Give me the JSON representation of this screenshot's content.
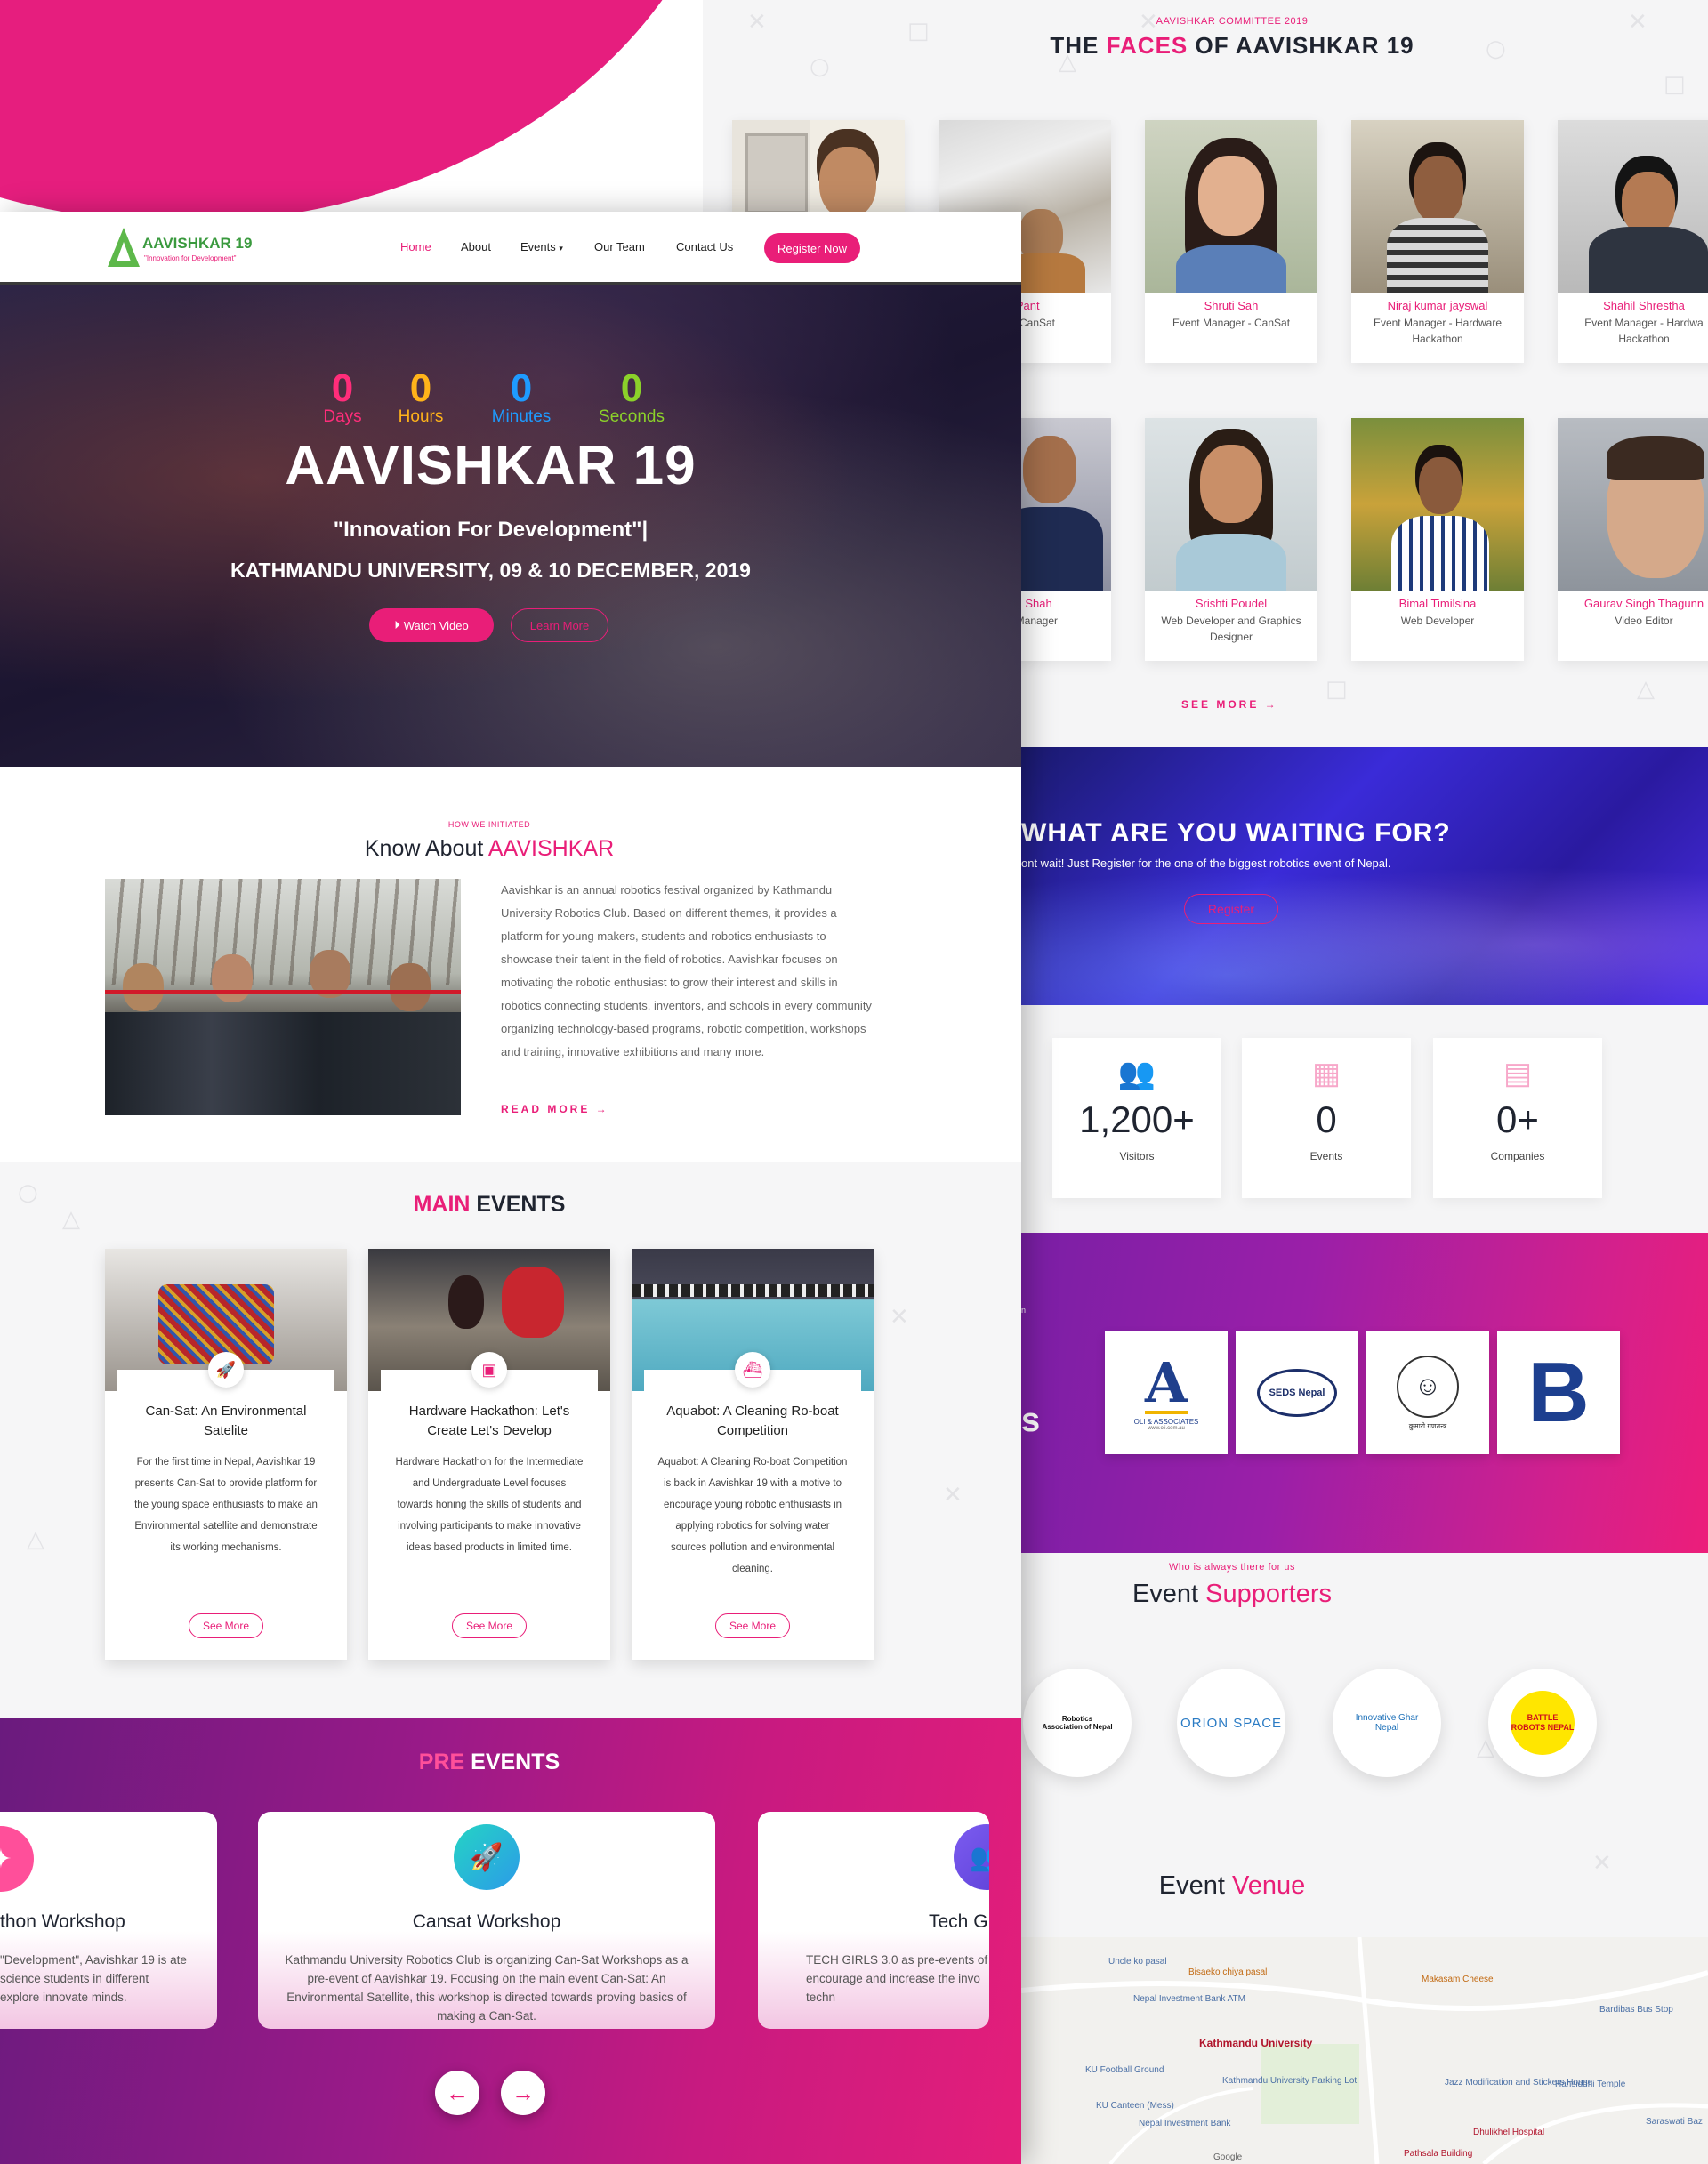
{
  "faces": {
    "eyebrow": "AAVISHKAR COMMITTEE 2019",
    "title_pre": "THE ",
    "title_accent": "FACES",
    "title_post": " OF AAVISHKAR 19",
    "row1": [
      {
        "name": "",
        "role": ""
      },
      {
        "name": "j Pant",
        "role": "ger - CanSat"
      },
      {
        "name": "Shruti Sah",
        "role": "Event Manager - CanSat"
      },
      {
        "name": "Niraj kumar jayswal",
        "role": "Event Manager - Hardware Hackathon"
      },
      {
        "name": "Shahil Shrestha",
        "role": "Event Manager - Hardwa Hackathon"
      }
    ],
    "row2": [
      {
        "name": "kash Shah",
        "role": "urce Manager"
      },
      {
        "name": "Srishti Poudel",
        "role": "Web Developer and Graphics Designer"
      },
      {
        "name": "Bimal Timilsina",
        "role": "Web Developer"
      },
      {
        "name": "Gaurav Singh Thagunn",
        "role": "Video Editor"
      }
    ],
    "see_more": "SEE MORE →"
  },
  "waiting": {
    "title": "WHAT ARE YOU WAITING FOR?",
    "text": "ont wait! Just Register for the one of the biggest robotics event of Nepal.",
    "button": "Register"
  },
  "stats": [
    {
      "icon": "users-icon",
      "value": "1,200+",
      "label": "Visitors"
    },
    {
      "icon": "calendar-icon",
      "value": "0",
      "label": "Events"
    },
    {
      "icon": "building-icon",
      "value": "0+",
      "label": "Companies"
    }
  ],
  "sponsors": {
    "fragment_letter": "s",
    "fragment_small": "n",
    "logos": [
      {
        "text": "OLI & ASSOCIATES",
        "sub": "www.oli.com.au"
      },
      {
        "text": "SEDS Nepal",
        "sub": ""
      },
      {
        "text": "कुमारी गणतन्त्र",
        "sub": ""
      },
      {
        "text": "B",
        "sub": ""
      }
    ]
  },
  "supporters": {
    "eyebrow": "Who is always there for us",
    "title_pre": "Event ",
    "title_accent": "Supporters",
    "logos": [
      {
        "text": "Robotics Association of Nepal"
      },
      {
        "text": "ORION SPACE"
      },
      {
        "text": "Innovative Ghar Nepal"
      },
      {
        "text": "BATTLE ROBOTS NEPAL"
      }
    ]
  },
  "venue": {
    "title_pre": "Event ",
    "title_accent": "Venue",
    "map_labels": [
      "Uncle ko pasal",
      "Bisaeko chiya pasal",
      "Makasam Cheese",
      "Nepal Investment Bank ATM",
      "Kathmandu University",
      "KU Football Ground",
      "Kathmandu University Parking Lot",
      "KU Canteen (Mess)",
      "Nepal Investment Bank",
      "Jazz Modification and Stickers House",
      "Hansiddhi Temple",
      "Bardibas Bus Stop",
      "Dhulikhel Hospital",
      "Saraswati Baz",
      "Pathsala Building",
      "Google"
    ]
  },
  "nav": {
    "logo_title": "AAVISHKAR 19",
    "logo_tagline": "\"Innovation for Development\"",
    "items": [
      "Home",
      "About",
      "Events",
      "Our Team",
      "Contact Us"
    ],
    "cta": "Register Now"
  },
  "hero": {
    "countdown": [
      {
        "value": "0",
        "label": "Days",
        "color": "#ff2d7a"
      },
      {
        "value": "0",
        "label": "Hours",
        "color": "#ffb31a"
      },
      {
        "value": "0",
        "label": "Minutes",
        "color": "#1e9bff"
      },
      {
        "value": "0",
        "label": "Seconds",
        "color": "#8bd12a"
      }
    ],
    "title": "AAVISHKAR 19",
    "tagline": "\"Innovation For Development\"|",
    "location": "KATHMANDU UNIVERSITY, 09 & 10 DECEMBER, 2019",
    "watch_video": "Watch Video",
    "learn_more": "Learn More"
  },
  "about": {
    "eyebrow": "HOW WE INITIATED",
    "title_pre": "Know About ",
    "title_accent": "AAVISHKAR",
    "text": "Aavishkar is an annual robotics festival organized by Kathmandu University Robotics Club. Based on different themes, it provides a platform for young makers, students and robotics enthusiasts to showcase their talent in the field of robotics. Aavishkar focuses on motivating the robotic enthusiast to grow their interest and skills in robotics connecting students, inventors, and schools in every community organizing technology-based programs, robotic competition, workshops and training, innovative exhibitions and many more.",
    "read_more": "READ MORE →"
  },
  "main_events": {
    "title_accent": "MAIN",
    "title_post": " EVENTS",
    "cards": [
      {
        "title": "Can-Sat: An Environmental Satelite",
        "text": "For the first time in Nepal, Aavishkar 19 presents Can-Sat to provide platform for the young space enthusiasts to make an Environmental satellite and demonstrate its working mechanisms.",
        "button": "See More",
        "icon": "rocket-icon"
      },
      {
        "title": "Hardware Hackathon: Let's Create Let's Develop",
        "text": "Hardware Hackathon for the Intermediate and Undergraduate Level focuses towards honing the skills of students and involving participants to make innovative ideas based products in limited time.",
        "button": "See More",
        "icon": "chip-icon"
      },
      {
        "title": "Aquabot: A Cleaning Ro-boat Competition",
        "text": "Aquabot: A Cleaning Ro-boat Competition is back in Aavishkar 19 with a motive to encourage young robotic enthusiasts in applying robotics for solving water sources pollution and environmental cleaning.",
        "button": "See More",
        "icon": "boat-icon"
      }
    ]
  },
  "pre_events": {
    "title_accent": "PRE",
    "title_post": " EVENTS",
    "cards": [
      {
        "title": "thon Workshop",
        "text": "\"Development\", Aavishkar 19 is ate science students in different explore innovate minds."
      },
      {
        "title": "Cansat Workshop",
        "text": "Kathmandu University Robotics Club is organizing Can-Sat Workshops as a pre-event of Aavishkar 19. Focusing on the main event Can-Sat: An Environmental Satellite, this workshop is directed towards proving basics of making a Can-Sat."
      },
      {
        "title": "Tech G",
        "text": "TECH GIRLS 3.0 as pre-events of encourage and increase the invo techn"
      }
    ],
    "prev": "←",
    "next": "→"
  }
}
